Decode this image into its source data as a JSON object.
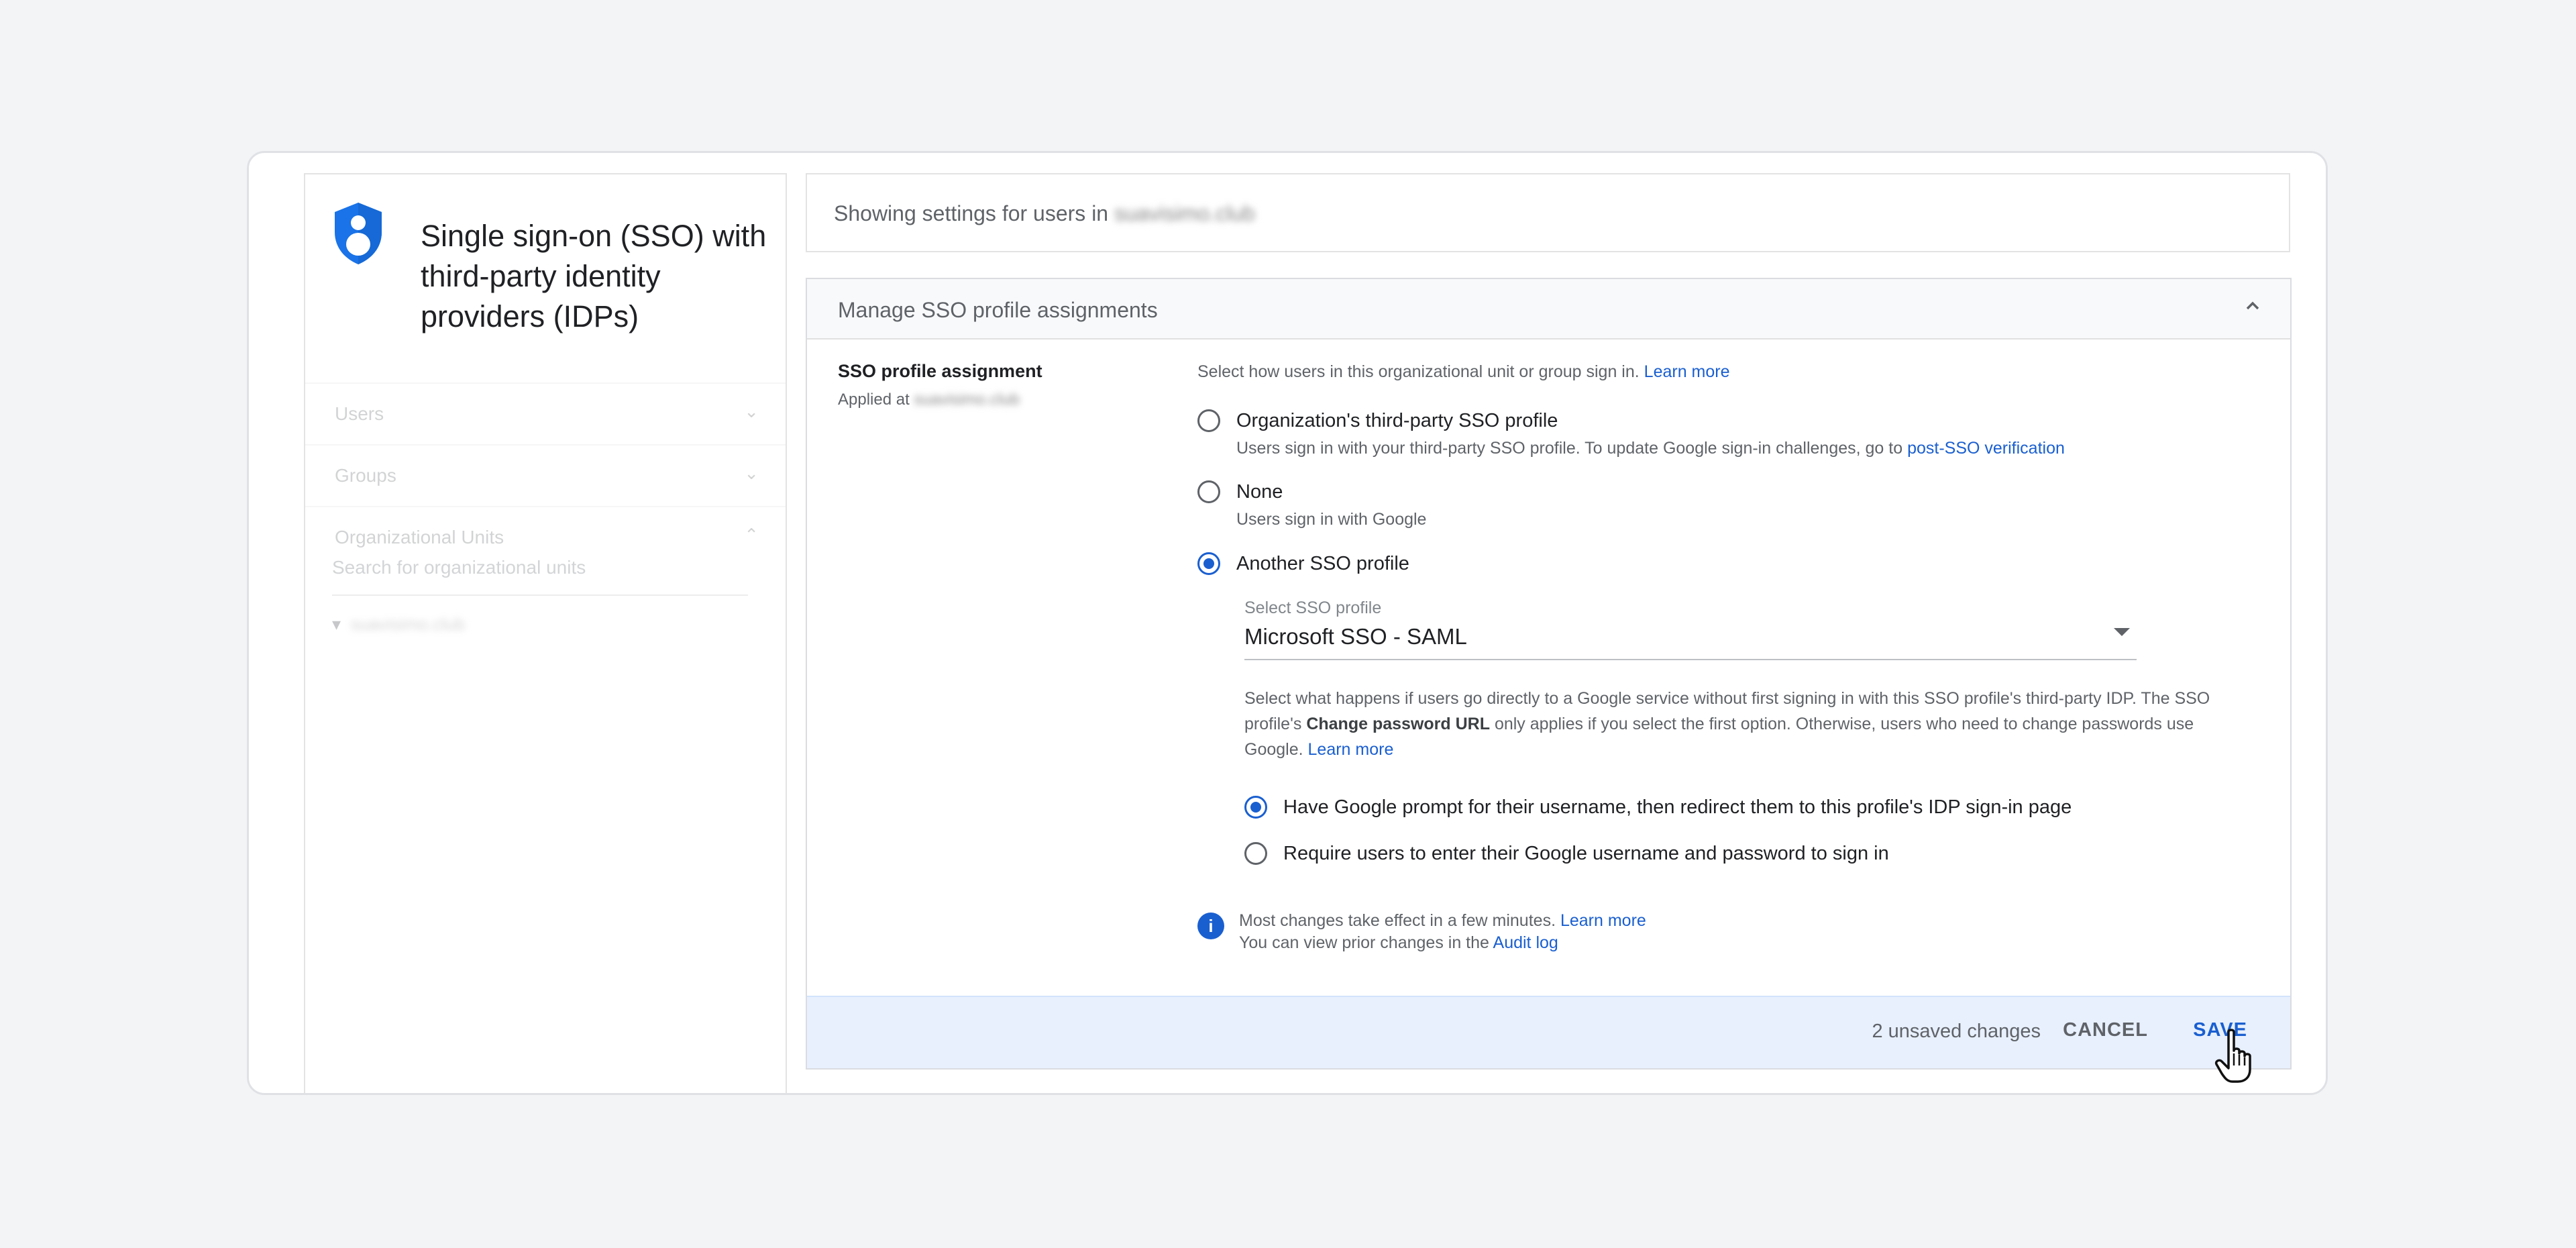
{
  "left_panel": {
    "title": "Single sign-on (SSO) with third-party identity providers (IDPs)",
    "nav": [
      {
        "label": "Users"
      },
      {
        "label": "Groups"
      },
      {
        "label": "Organizational Units"
      }
    ],
    "search_placeholder": "Search for organizational units",
    "ou_root": "suavisimo.club"
  },
  "header": {
    "showing_prefix": "Showing settings for users in",
    "domain": "suavisimo.club"
  },
  "card": {
    "title": "Manage SSO profile assignments",
    "setting_label": "SSO profile assignment",
    "applied_prefix": "Applied at",
    "applied_domain": "suavisimo.club",
    "intro": "Select how users in this organizational unit or group sign in.",
    "intro_link": "Learn more",
    "options": [
      {
        "label": "Organization's third-party SSO profile",
        "desc": "Users sign in with your third-party SSO profile. To update Google sign-in challenges, go to",
        "desc_link": "post-SSO verification",
        "selected": false
      },
      {
        "label": "None",
        "desc": "Users sign in with Google",
        "selected": false
      },
      {
        "label": "Another SSO profile",
        "selected": true
      }
    ],
    "select": {
      "label": "Select SSO profile",
      "value": "Microsoft SSO - SAML"
    },
    "para_1": "Select what happens if users go directly to a Google service without first signing in with this SSO profile's third-party IDP. The SSO profile's",
    "para_bold": "Change password URL",
    "para_2": "only applies if you select the first option. Otherwise, users who need to change passwords use Google.",
    "para_link": "Learn more",
    "sub_options": [
      {
        "label": "Have Google prompt for their username, then redirect them to this profile's IDP sign-in page",
        "selected": true
      },
      {
        "label": "Require users to enter their Google username and password to sign in",
        "selected": false
      }
    ],
    "info_line1": "Most changes take effect in a few minutes.",
    "info_link1": "Learn more",
    "info_line2": "You can view prior changes in the",
    "info_link2": "Audit log"
  },
  "footer": {
    "unsaved": "2 unsaved changes",
    "cancel": "CANCEL",
    "save": "SAVE"
  },
  "colors": {
    "accent": "#1a5fd0",
    "shield": "#1a73e8",
    "footer_bg": "#e8f0fe"
  }
}
